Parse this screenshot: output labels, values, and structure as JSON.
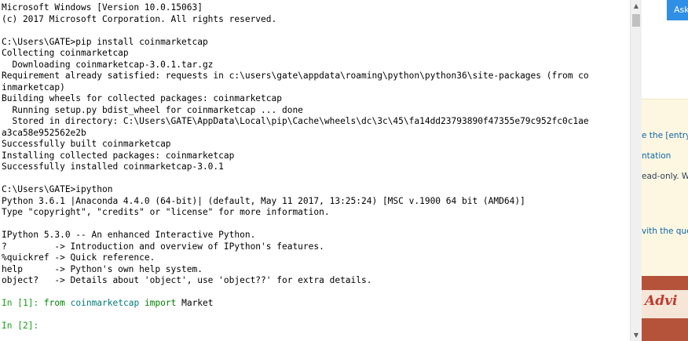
{
  "console": {
    "lines": [
      [
        {
          "t": "Microsoft Windows [Version 10.0.15063]",
          "c": "plain"
        }
      ],
      [
        {
          "t": "(c) 2017 Microsoft Corporation. All rights reserved.",
          "c": "plain"
        }
      ],
      [
        {
          "t": "",
          "c": "plain"
        }
      ],
      [
        {
          "t": "C:\\Users\\GATE>pip install coinmarketcap",
          "c": "plain"
        }
      ],
      [
        {
          "t": "Collecting coinmarketcap",
          "c": "plain"
        }
      ],
      [
        {
          "t": "  Downloading coinmarketcap-3.0.1.tar.gz",
          "c": "plain"
        }
      ],
      [
        {
          "t": "Requirement already satisfied: requests in c:\\users\\gate\\appdata\\roaming\\python\\python36\\site-packages (from co",
          "c": "plain"
        }
      ],
      [
        {
          "t": "inmarketcap)",
          "c": "plain"
        }
      ],
      [
        {
          "t": "Building wheels for collected packages: coinmarketcap",
          "c": "plain"
        }
      ],
      [
        {
          "t": "  Running setup.py bdist_wheel for coinmarketcap ... done",
          "c": "plain"
        }
      ],
      [
        {
          "t": "  Stored in directory: C:\\Users\\GATE\\AppData\\Local\\pip\\Cache\\wheels\\dc\\3c\\45\\fa14dd23793890f47355e79c952fc0c1ae",
          "c": "plain"
        }
      ],
      [
        {
          "t": "a3ca58e952562e2b",
          "c": "plain"
        }
      ],
      [
        {
          "t": "Successfully built coinmarketcap",
          "c": "plain"
        }
      ],
      [
        {
          "t": "Installing collected packages: coinmarketcap",
          "c": "plain"
        }
      ],
      [
        {
          "t": "Successfully installed coinmarketcap-3.0.1",
          "c": "plain"
        }
      ],
      [
        {
          "t": "",
          "c": "plain"
        }
      ],
      [
        {
          "t": "C:\\Users\\GATE>ipython",
          "c": "plain"
        }
      ],
      [
        {
          "t": "Python 3.6.1 |Anaconda 4.4.0 (64-bit)| (default, May 11 2017, 13:25:24) [MSC v.1900 64 bit (AMD64)]",
          "c": "plain"
        }
      ],
      [
        {
          "t": "Type \"copyright\", \"credits\" or \"license\" for more information.",
          "c": "plain"
        }
      ],
      [
        {
          "t": "",
          "c": "plain"
        }
      ],
      [
        {
          "t": "IPython 5.3.0 -- An enhanced Interactive Python.",
          "c": "plain"
        }
      ],
      [
        {
          "t": "?         -> Introduction and overview of IPython's features.",
          "c": "plain"
        }
      ],
      [
        {
          "t": "%quickref -> Quick reference.",
          "c": "plain"
        }
      ],
      [
        {
          "t": "help      -> Python's own help system.",
          "c": "plain"
        }
      ],
      [
        {
          "t": "object?   -> Details about 'object', use 'object??' for extra details.",
          "c": "plain"
        }
      ],
      [
        {
          "t": "",
          "c": "plain"
        }
      ],
      [
        {
          "t": "In [",
          "c": "prompt-green"
        },
        {
          "t": "1",
          "c": "prompt-green"
        },
        {
          "t": "]: ",
          "c": "prompt-green"
        },
        {
          "t": "from",
          "c": "kw-green"
        },
        {
          "t": " ",
          "c": "plain"
        },
        {
          "t": "coinmarketcap",
          "c": "mod-teal"
        },
        {
          "t": " ",
          "c": "plain"
        },
        {
          "t": "import",
          "c": "kw-green"
        },
        {
          "t": " Market",
          "c": "plain"
        }
      ],
      [
        {
          "t": "",
          "c": "plain"
        }
      ],
      [
        {
          "t": "In [",
          "c": "prompt-green"
        },
        {
          "t": "2",
          "c": "prompt-green"
        },
        {
          "t": "]:",
          "c": "prompt-green"
        }
      ]
    ]
  },
  "scrollbar": {
    "up_arrow": "▲",
    "down_arrow": "▼"
  },
  "browser": {
    "ask_button_label": "Ask",
    "info_line1": "e the [entry]",
    "info_line2": "ntation",
    "info_line3": "ead-only. Wh",
    "info_line4": "vith the ques",
    "ad_text": "Advi"
  },
  "colors": {
    "prompt": "#1aa01a",
    "keyword": "#008000",
    "module": "#007a7a",
    "ask_button": "#2f8ee5"
  }
}
